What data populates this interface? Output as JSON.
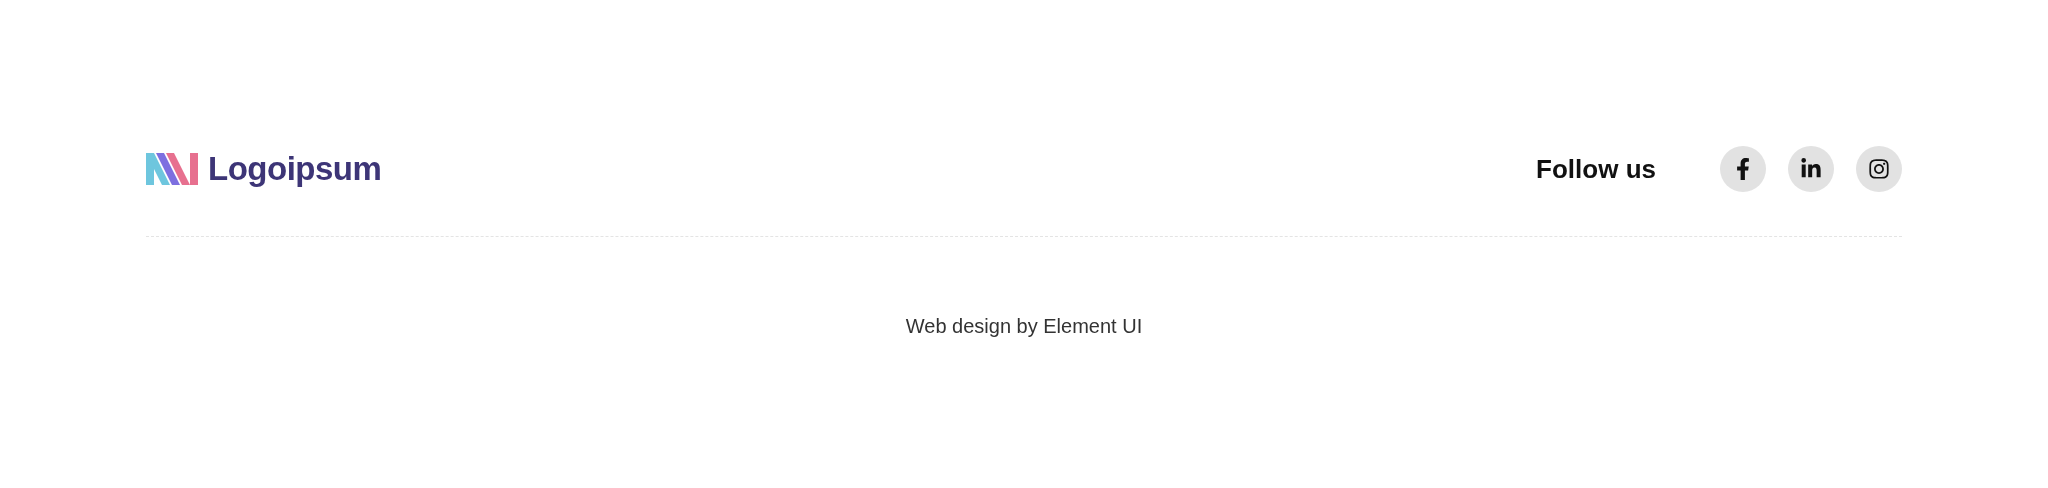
{
  "brand": {
    "name": "Logoipsum"
  },
  "follow": {
    "label": "Follow us",
    "links": [
      {
        "kind": "facebook"
      },
      {
        "kind": "linkedin"
      },
      {
        "kind": "instagram"
      }
    ]
  },
  "credit": "Web design by Element UI"
}
